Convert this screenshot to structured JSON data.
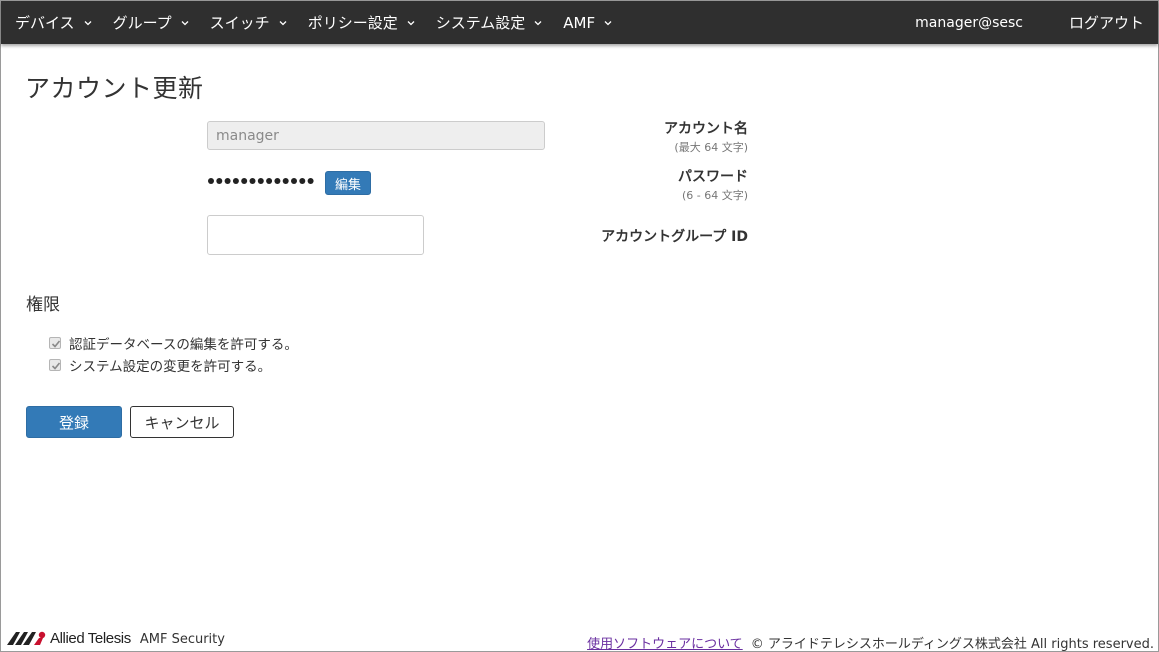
{
  "navbar": {
    "menu": [
      {
        "label": "デバイス",
        "icon": "chevron-down-icon"
      },
      {
        "label": "グループ",
        "icon": "chevron-down-icon"
      },
      {
        "label": "スイッチ",
        "icon": "chevron-down-icon"
      },
      {
        "label": "ポリシー設定",
        "icon": "chevron-down-icon"
      },
      {
        "label": "システム設定",
        "icon": "chevron-down-icon"
      },
      {
        "label": "AMF",
        "icon": "chevron-down-icon"
      }
    ],
    "user": "manager@sesc",
    "logout": "ログアウト",
    "background": "#2f2f2f"
  },
  "page": {
    "title": "アカウント更新"
  },
  "form": {
    "account_name": {
      "label": "アカウント名",
      "hint": "(最大 64 文字)",
      "value": "manager",
      "disabled": true
    },
    "password": {
      "label": "パスワード",
      "hint": "(6 - 64 文字)",
      "masked_value": "●●●●●●●●●●●●●",
      "edit_button": "編集"
    },
    "account_group_id": {
      "label": "アカウントグループ ID",
      "value": ""
    }
  },
  "permissions": {
    "title": "権限",
    "items": [
      {
        "label": "認証データベースの編集を許可する。",
        "checked": true,
        "disabled": true
      },
      {
        "label": "システム設定の変更を許可する。",
        "checked": true,
        "disabled": true
      }
    ]
  },
  "actions": {
    "submit": "登録",
    "cancel": "キャンセル",
    "primary_color": "#337ab7"
  },
  "footer": {
    "brand": "Allied Telesis",
    "product": "AMF Security",
    "about_link": "使用ソフトウェアについて",
    "copyright": "© アライドテレシスホールディングス株式会社 All rights reserved."
  }
}
